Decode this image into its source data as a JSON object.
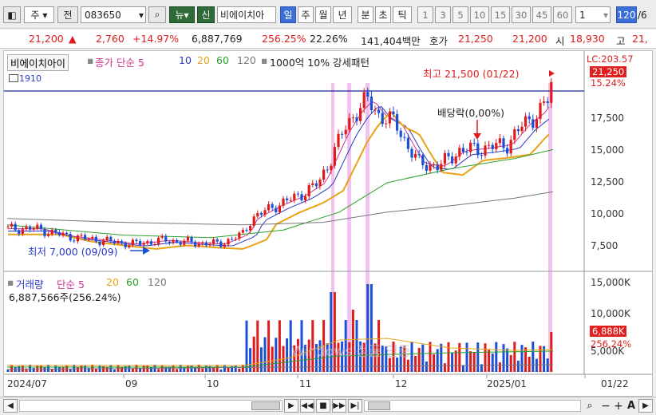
{
  "toolbar": {
    "market": "주",
    "type": "전",
    "code": "083650",
    "news": "뉴",
    "credit": "신",
    "name": "비에이치아",
    "periods": [
      "일",
      "주",
      "월",
      "년"
    ],
    "mins": [
      "분",
      "초",
      "틱"
    ],
    "nums": [
      "1",
      "3",
      "5",
      "10",
      "15",
      "30",
      "45",
      "60"
    ],
    "unit": "1",
    "count": "120",
    "count_suffix": "/6"
  },
  "price": {
    "last": "21,200",
    "up_arrow": "▲",
    "change": "2,760",
    "rate": "+14.97%",
    "volume": "6,887,769",
    "vol_ratio": "256.25%",
    "turnover": "22.26%",
    "amount": "141,404백만",
    "ask_label": "호가",
    "ask": "21,250",
    "bid": "21,200",
    "open_label": "시",
    "open": "18,930",
    "high_label": "고",
    "high": "21,"
  },
  "price_panel": {
    "legend_name": "비에이치아이",
    "legend_ma": "종가 단순 5",
    "ma10": "10",
    "ma20": "20",
    "ma60": "60",
    "ma120": "120",
    "legend_pattern": "1000억 10% 강세패턴",
    "sub": "1910",
    "high_note": "최고 21,500 (01/22)",
    "low_note": "최저 7,000 (09/09)",
    "dividend_note": "배당락(0,00%)",
    "lc": "LC:203.57",
    "tag_price": "21,250",
    "tag_pct": "15.24%",
    "yticks": [
      "17,500",
      "15,000",
      "12,500",
      "10,000",
      "7,500"
    ]
  },
  "volume_panel": {
    "legend_name": "거래량",
    "legend_ma": "단순 5",
    "ma20": "20",
    "ma60": "60",
    "ma120": "120",
    "value": "6,887,566주(256.24%)",
    "tag_vol": "6,888K",
    "tag_pct": "256.24%",
    "yticks": [
      "15,000K",
      "10,000K",
      "5,000K"
    ]
  },
  "x_axis": [
    "2024/07",
    "09",
    "10",
    "11",
    "12",
    "2025/01",
    "01/22"
  ],
  "colors": {
    "up": "#e11b1b",
    "down": "#1a4fd6",
    "ma5": "#d0338f",
    "ma10": "#2a38c8",
    "ma20": "#e8a317",
    "ma60": "#2aa02a",
    "ma120": "#777777",
    "highlight": "#f2c2ef"
  },
  "watermark": "Windows 정품 인증"
}
